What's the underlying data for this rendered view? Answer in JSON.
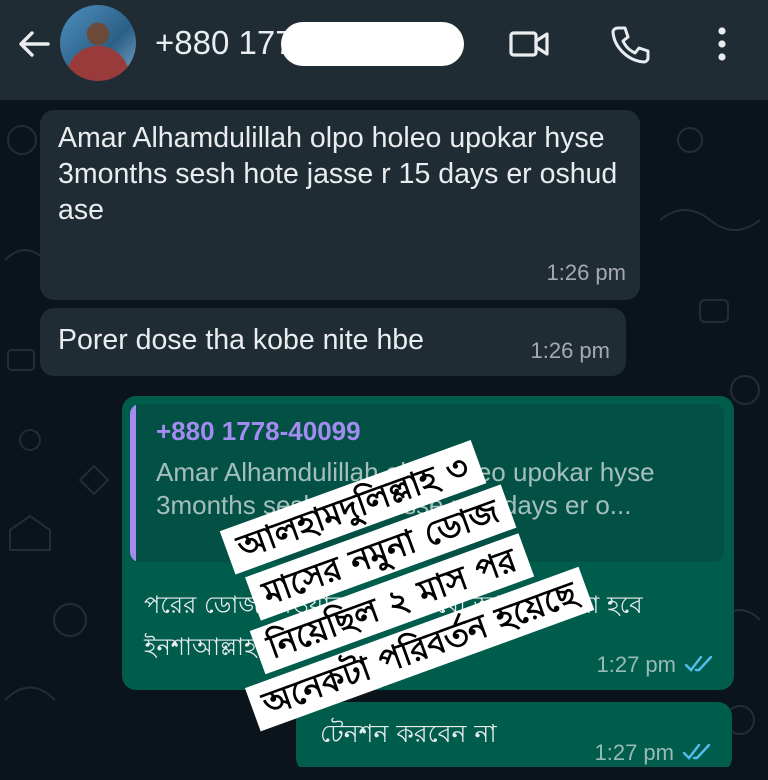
{
  "header": {
    "back_icon": "arrow-left-icon",
    "contact_name": "+880 1778-400099",
    "icons": [
      "video-call-icon",
      "phone-icon",
      "more-vert-icon"
    ]
  },
  "messages": [
    {
      "direction": "incoming",
      "text": "Amar Alhamdulillah olpo holeo upokar hyse\n3months sesh hote jasse r 15 days er oshud ase",
      "time": "1:26 pm"
    },
    {
      "direction": "incoming",
      "text": "Porer dose tha kobe nite hbe",
      "time": "1:26 pm"
    },
    {
      "direction": "outgoing",
      "quote": {
        "name": "+880 1778-40099",
        "text": "Amar Alhamdulillah olpo holeo upokar hyse 3months sesh hote jasse r 15 days er o..."
      },
      "text": "পরের ডোজ নেওয়ার পরে দেখবো আরও ভালো হবে ইনশাআল্লাহ",
      "time": "1:27 pm",
      "status": "read"
    },
    {
      "direction": "outgoing",
      "text": "টেনশন করবেন না",
      "time": "1:27 pm",
      "status": "read"
    }
  ],
  "overlay": {
    "lines": [
      "আলহামদুলিল্লাহ ৩",
      "মাসের নমুনা ডোজ",
      "নিয়েছিল ২ মাস পর",
      "অনেকটা পরিবর্তন হয়েছে"
    ]
  },
  "colors": {
    "header_bg": "#1f2c34",
    "chat_bg": "#0b141a",
    "incoming_bubble": "#202c33",
    "outgoing_bubble": "#005c4b",
    "read_ticks": "#53bdeb",
    "quote_accent": "#a48bf2"
  }
}
